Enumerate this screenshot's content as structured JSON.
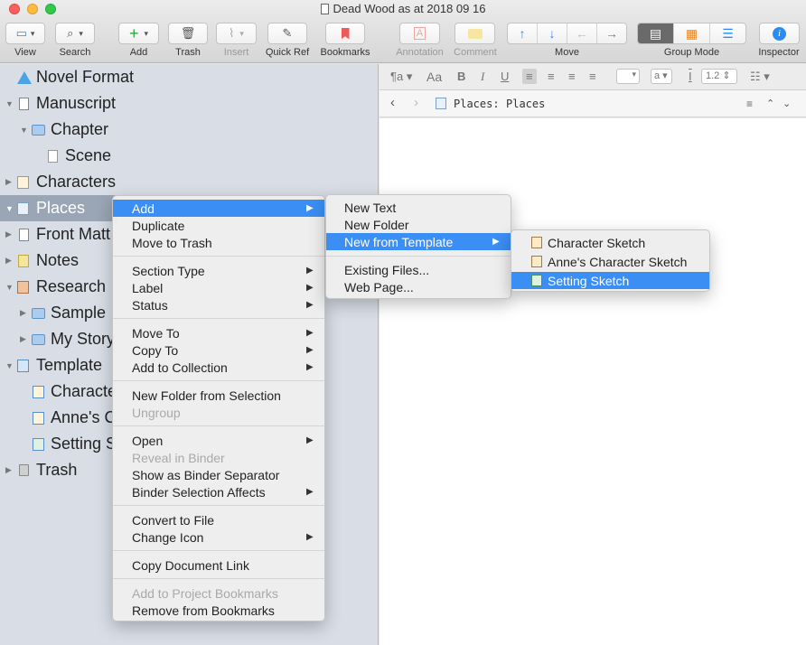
{
  "window": {
    "title": "Dead Wood as at 2018 09 16"
  },
  "toolbar": {
    "view_label": "View",
    "search_label": "Search",
    "add_label": "Add",
    "trash_label": "Trash",
    "insert_label": "Insert",
    "quickref_label": "Quick Ref",
    "bookmarks_label": "Bookmarks",
    "annotation_label": "Annotation",
    "comment_label": "Comment",
    "move_label": "Move",
    "groupmode_label": "Group Mode",
    "inspector_label": "Inspector"
  },
  "binder": {
    "items": [
      {
        "label": "Novel Format"
      },
      {
        "label": "Manuscript"
      },
      {
        "label": "Chapter"
      },
      {
        "label": "Scene"
      },
      {
        "label": "Characters"
      },
      {
        "label": "Places"
      },
      {
        "label": "Front Matt"
      },
      {
        "label": "Notes"
      },
      {
        "label": "Research"
      },
      {
        "label": "Sample"
      },
      {
        "label": "My Story"
      },
      {
        "label": "Template"
      },
      {
        "label": "Characte"
      },
      {
        "label": "Anne's C"
      },
      {
        "label": "Setting S"
      },
      {
        "label": "Trash"
      }
    ]
  },
  "format_bar": {
    "line_spacing": "1.2",
    "font_style": "a"
  },
  "path_bar": {
    "prefix": "Places:",
    "title": "Places"
  },
  "context_menu": {
    "add": "Add",
    "duplicate": "Duplicate",
    "move_to_trash": "Move to Trash",
    "section_type": "Section Type",
    "label": "Label",
    "status": "Status",
    "move_to": "Move To",
    "copy_to": "Copy To",
    "add_to_collection": "Add to Collection",
    "new_folder_from_selection": "New Folder from Selection",
    "ungroup": "Ungroup",
    "open": "Open",
    "reveal_in_binder": "Reveal in Binder",
    "show_as_binder_separator": "Show as Binder Separator",
    "binder_selection_affects": "Binder Selection Affects",
    "convert_to_file": "Convert to File",
    "change_icon": "Change Icon",
    "copy_document_link": "Copy Document Link",
    "add_to_project_bookmarks": "Add to Project Bookmarks",
    "remove_from_bookmarks": "Remove from Bookmarks"
  },
  "add_submenu": {
    "new_text": "New Text",
    "new_folder": "New Folder",
    "new_from_template": "New from Template",
    "existing_files": "Existing Files...",
    "web_page": "Web Page..."
  },
  "template_submenu": {
    "character_sketch": "Character Sketch",
    "annes_character_sketch": "Anne's Character Sketch",
    "setting_sketch": "Setting Sketch"
  }
}
